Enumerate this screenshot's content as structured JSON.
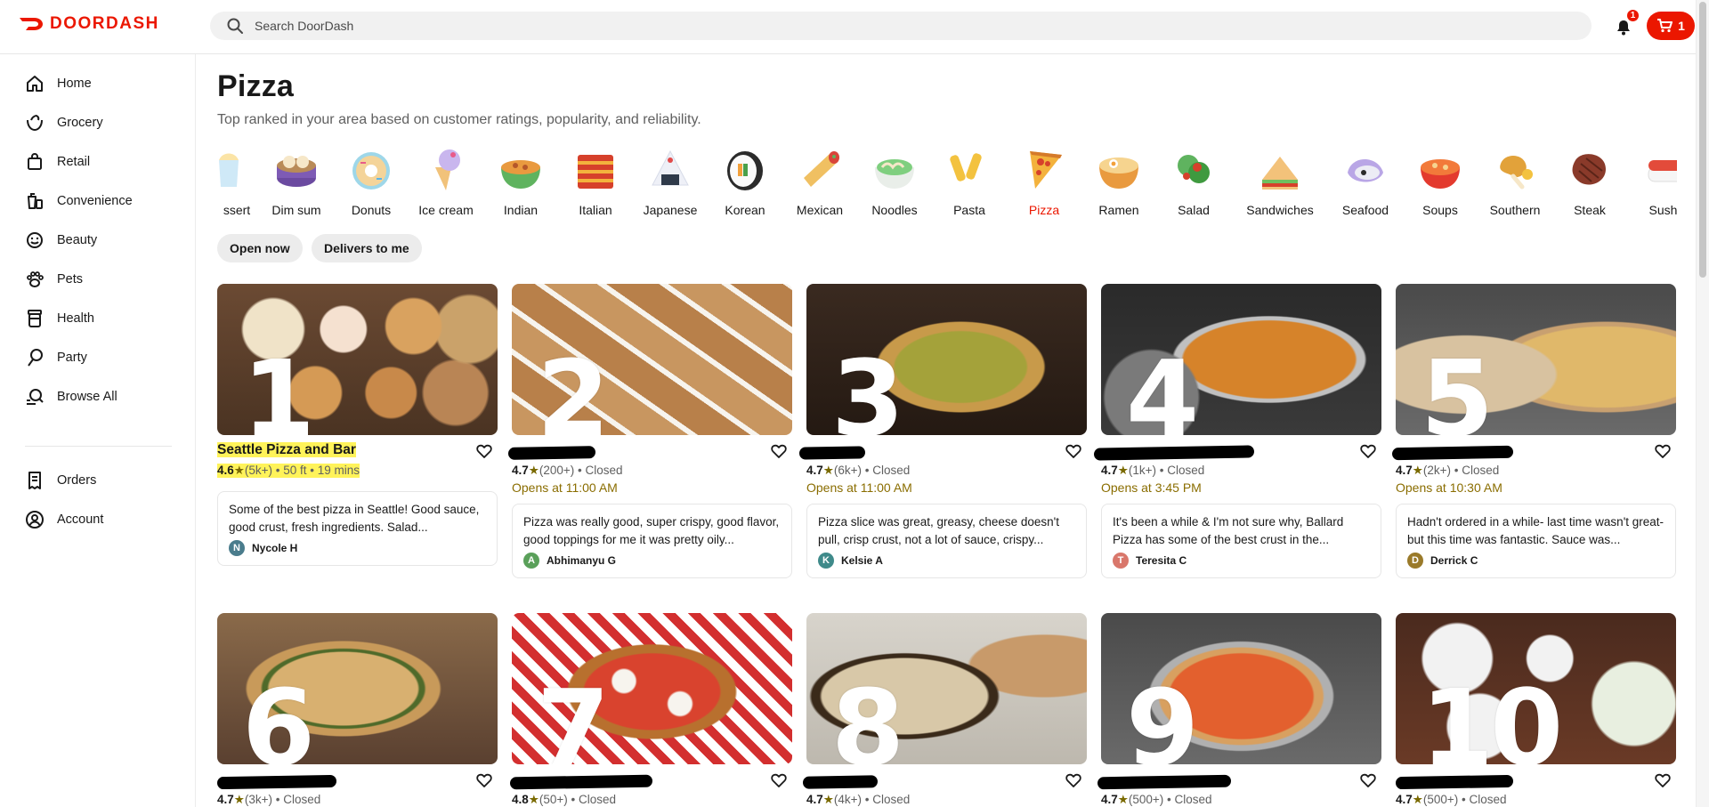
{
  "header": {
    "logo_text": "DOORDASH",
    "search_placeholder": "Search DoorDash",
    "notification_count": "1",
    "cart_count": "1",
    "brand_color": "#eb1700"
  },
  "sidebar": {
    "items": [
      {
        "label": "Home",
        "icon": "home-icon"
      },
      {
        "label": "Grocery",
        "icon": "grocery-icon"
      },
      {
        "label": "Retail",
        "icon": "retail-bag-icon"
      },
      {
        "label": "Convenience",
        "icon": "convenience-icon"
      },
      {
        "label": "Beauty",
        "icon": "beauty-icon"
      },
      {
        "label": "Pets",
        "icon": "paw-icon"
      },
      {
        "label": "Health",
        "icon": "health-icon"
      },
      {
        "label": "Party",
        "icon": "party-balloon-icon"
      },
      {
        "label": "Browse All",
        "icon": "browse-search-icon"
      }
    ],
    "account_items": [
      {
        "label": "Orders",
        "icon": "receipt-icon"
      },
      {
        "label": "Account",
        "icon": "account-icon"
      }
    ]
  },
  "page": {
    "title": "Pizza",
    "subtitle": "Top ranked in your area based on customer ratings, popularity, and reliability."
  },
  "categories": [
    {
      "label": "ssert",
      "icon": "dessert-icon"
    },
    {
      "label": "Dim sum",
      "icon": "dim-sum-icon"
    },
    {
      "label": "Donuts",
      "icon": "donut-icon"
    },
    {
      "label": "Ice cream",
      "icon": "ice-cream-icon"
    },
    {
      "label": "Indian",
      "icon": "indian-curry-icon"
    },
    {
      "label": "Italian",
      "icon": "lasagna-icon"
    },
    {
      "label": "Japanese",
      "icon": "onigiri-icon"
    },
    {
      "label": "Korean",
      "icon": "kimbap-icon"
    },
    {
      "label": "Mexican",
      "icon": "burrito-icon"
    },
    {
      "label": "Noodles",
      "icon": "noodle-bowl-icon"
    },
    {
      "label": "Pasta",
      "icon": "pasta-icon"
    },
    {
      "label": "Pizza",
      "icon": "pizza-slice-icon",
      "active": true
    },
    {
      "label": "Ramen",
      "icon": "ramen-icon"
    },
    {
      "label": "Salad",
      "icon": "salad-icon"
    },
    {
      "label": "Sandwiches",
      "icon": "sandwich-icon"
    },
    {
      "label": "Seafood",
      "icon": "seafood-icon"
    },
    {
      "label": "Soups",
      "icon": "soup-icon"
    },
    {
      "label": "Southern",
      "icon": "fried-chicken-icon"
    },
    {
      "label": "Steak",
      "icon": "steak-icon"
    },
    {
      "label": "Sushi",
      "icon": "sushi-icon"
    }
  ],
  "filters": [
    "Open now",
    "Delivers to me"
  ],
  "stores": [
    {
      "rank": "1",
      "name": "Seattle Pizza and Bar",
      "rating": "4.6",
      "reviews": "(5k+)",
      "distance": "50 ft",
      "time": "19 mins",
      "status": "",
      "opens": "",
      "review": "Some of the best pizza in Seattle! Good sauce, good crust, fresh ingredients. Salad...",
      "reviewer": "Nycole H",
      "initial": "N",
      "avatar_color": "#4a7c8c",
      "highlighted": true
    },
    {
      "rank": "2",
      "name": "",
      "rating": "4.7",
      "reviews": "(200+)",
      "status": "Closed",
      "opens": "Opens at 11:00 AM",
      "review": "Pizza was really good, super crispy, good flavor, good toppings for me it was pretty oily...",
      "reviewer": "Abhimanyu G",
      "initial": "A",
      "avatar_color": "#5aa05a"
    },
    {
      "rank": "3",
      "name": "",
      "rating": "4.7",
      "reviews": "(6k+)",
      "status": "Closed",
      "opens": "Opens at 11:00 AM",
      "review": "Pizza slice was great, greasy, cheese doesn't pull, crisp crust, not a lot of sauce, crispy...",
      "reviewer": "Kelsie A",
      "initial": "K",
      "avatar_color": "#3f8a8a"
    },
    {
      "rank": "4",
      "name": "",
      "rating": "4.7",
      "reviews": "(1k+)",
      "status": "Closed",
      "opens": "Opens at 3:45 PM",
      "review": "It's been a while & I'm not sure why, Ballard Pizza has some of the best crust in the...",
      "reviewer": "Teresita C",
      "initial": "T",
      "avatar_color": "#d9776b"
    },
    {
      "rank": "5",
      "name": "",
      "rating": "4.7",
      "reviews": "(2k+)",
      "status": "Closed",
      "opens": "Opens at 10:30 AM",
      "review": "Hadn't ordered in a while- last time wasn't great- but this time was fantastic. Sauce was...",
      "reviewer": "Derrick C",
      "initial": "D",
      "avatar_color": "#9a7a2a"
    },
    {
      "rank": "6",
      "name": "",
      "rating": "4.7",
      "reviews": "(3k+)",
      "status": "Closed"
    },
    {
      "rank": "7",
      "name": "",
      "rating": "4.8",
      "reviews": "(50+)",
      "status": "Closed"
    },
    {
      "rank": "8",
      "name": "",
      "rating": "4.7",
      "reviews": "(4k+)",
      "status": "Closed"
    },
    {
      "rank": "9",
      "name": "",
      "rating": "4.7",
      "reviews": "(500+)",
      "status": "Closed"
    },
    {
      "rank": "10",
      "name": "",
      "rating": "4.7",
      "reviews": "(500+)",
      "status": "Closed"
    }
  ]
}
